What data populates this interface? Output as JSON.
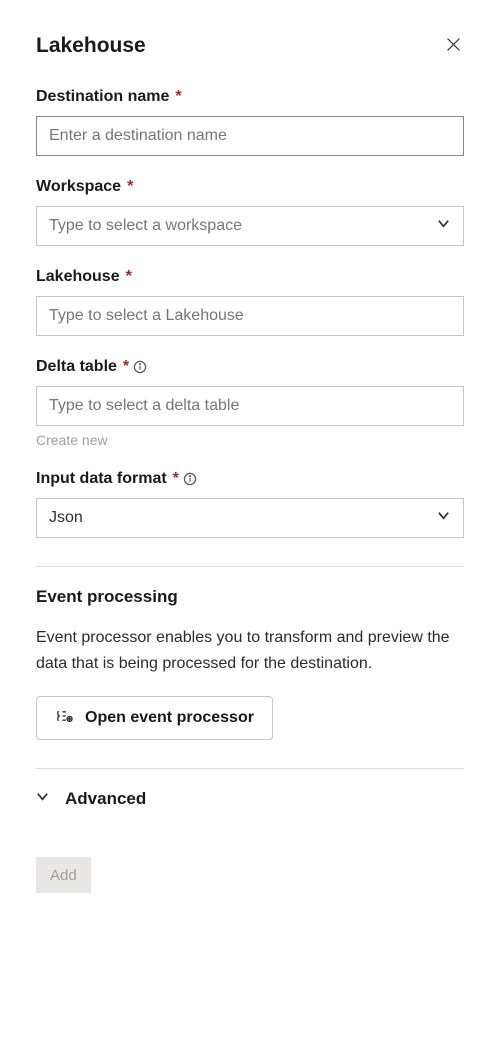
{
  "header": {
    "title": "Lakehouse"
  },
  "fields": {
    "destination_name": {
      "label": "Destination name",
      "placeholder": "Enter a destination name",
      "value": ""
    },
    "workspace": {
      "label": "Workspace",
      "placeholder": "Type to select a workspace",
      "value": ""
    },
    "lakehouse": {
      "label": "Lakehouse",
      "placeholder": "Type to select a Lakehouse",
      "value": ""
    },
    "delta_table": {
      "label": "Delta table",
      "placeholder": "Type to select a delta table",
      "value": "",
      "create_new": "Create new"
    },
    "input_data_format": {
      "label": "Input data format",
      "selected": "Json"
    }
  },
  "event_processing": {
    "title": "Event processing",
    "description": "Event processor enables you to transform and preview the data that is being processed for the destination.",
    "button_label": "Open event processor"
  },
  "advanced": {
    "title": "Advanced"
  },
  "actions": {
    "add": "Add"
  }
}
